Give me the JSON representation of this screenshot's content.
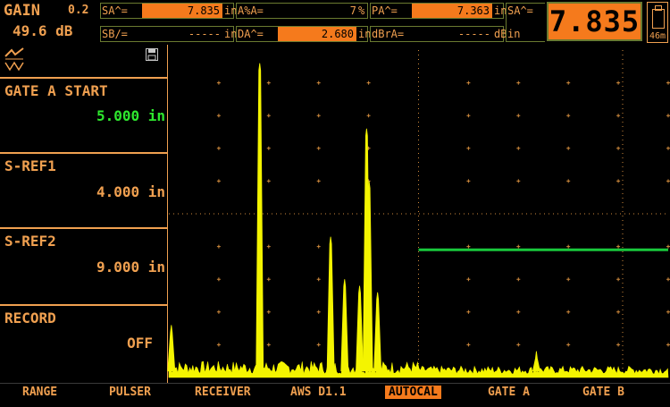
{
  "gain": {
    "label": "GAIN",
    "step": "0.2",
    "value": "49.6 dB"
  },
  "readings": [
    {
      "label": "SA^=",
      "value": "7.835",
      "unit": "in",
      "highlighted": true
    },
    {
      "label": "A%A=",
      "value": "7",
      "unit": "%",
      "highlighted": false
    },
    {
      "label": "PA^=",
      "value": "7.363",
      "unit": "in",
      "highlighted": true
    },
    {
      "label": "SB/=",
      "value": "-----",
      "unit": "in",
      "highlighted": false
    },
    {
      "label": "DA^=",
      "value": "2.680",
      "unit": "in",
      "highlighted": true
    },
    {
      "label": "dBrA=",
      "value": "-----",
      "unit": "dB",
      "highlighted": false
    }
  ],
  "big_reading": {
    "label": "SA^=",
    "value": "7.835",
    "unit": "in"
  },
  "battery": {
    "label": "46m"
  },
  "params": [
    {
      "title": "GATE A START",
      "value": "5.000 in",
      "active": true
    },
    {
      "title": "S-REF1",
      "value": "4.000 in",
      "active": false
    },
    {
      "title": "S-REF2",
      "value": "9.000 in",
      "active": false
    },
    {
      "title": "RECORD",
      "value": "OFF",
      "active": false
    }
  ],
  "menu": [
    {
      "label": "RANGE",
      "active": false
    },
    {
      "label": "PULSER",
      "active": false
    },
    {
      "label": "RECEIVER",
      "active": false
    },
    {
      "label": "AWS D1.1",
      "active": false
    },
    {
      "label": "AUTOCAL",
      "active": true
    },
    {
      "label": "GATE A",
      "active": false
    },
    {
      "label": "GATE B",
      "active": false
    }
  ],
  "colors": {
    "accent": "#f57a1c",
    "text": "#f0a050",
    "active_value": "#2ee82e",
    "gate": "#19c83c",
    "signal": "#f4f400",
    "frame": "#6a7a30"
  },
  "icons": {
    "waveform_toggle": "waveform-icon",
    "save": "floppy-disk-icon"
  },
  "chart_data": {
    "type": "line",
    "title": "",
    "xlabel": "",
    "ylabel": "",
    "x_range": [
      0,
      10
    ],
    "y_range": [
      0,
      100
    ],
    "grid": true,
    "gate_a": {
      "start": 5.0,
      "end": 10.0,
      "level": 39
    },
    "echo_peaks": [
      {
        "x": 0.05,
        "y": 16
      },
      {
        "x": 1.82,
        "y": 96
      },
      {
        "x": 3.24,
        "y": 43
      },
      {
        "x": 3.52,
        "y": 30
      },
      {
        "x": 3.82,
        "y": 28
      },
      {
        "x": 3.96,
        "y": 76
      },
      {
        "x": 4.01,
        "y": 60
      },
      {
        "x": 4.18,
        "y": 26
      },
      {
        "x": 7.36,
        "y": 8
      }
    ]
  }
}
